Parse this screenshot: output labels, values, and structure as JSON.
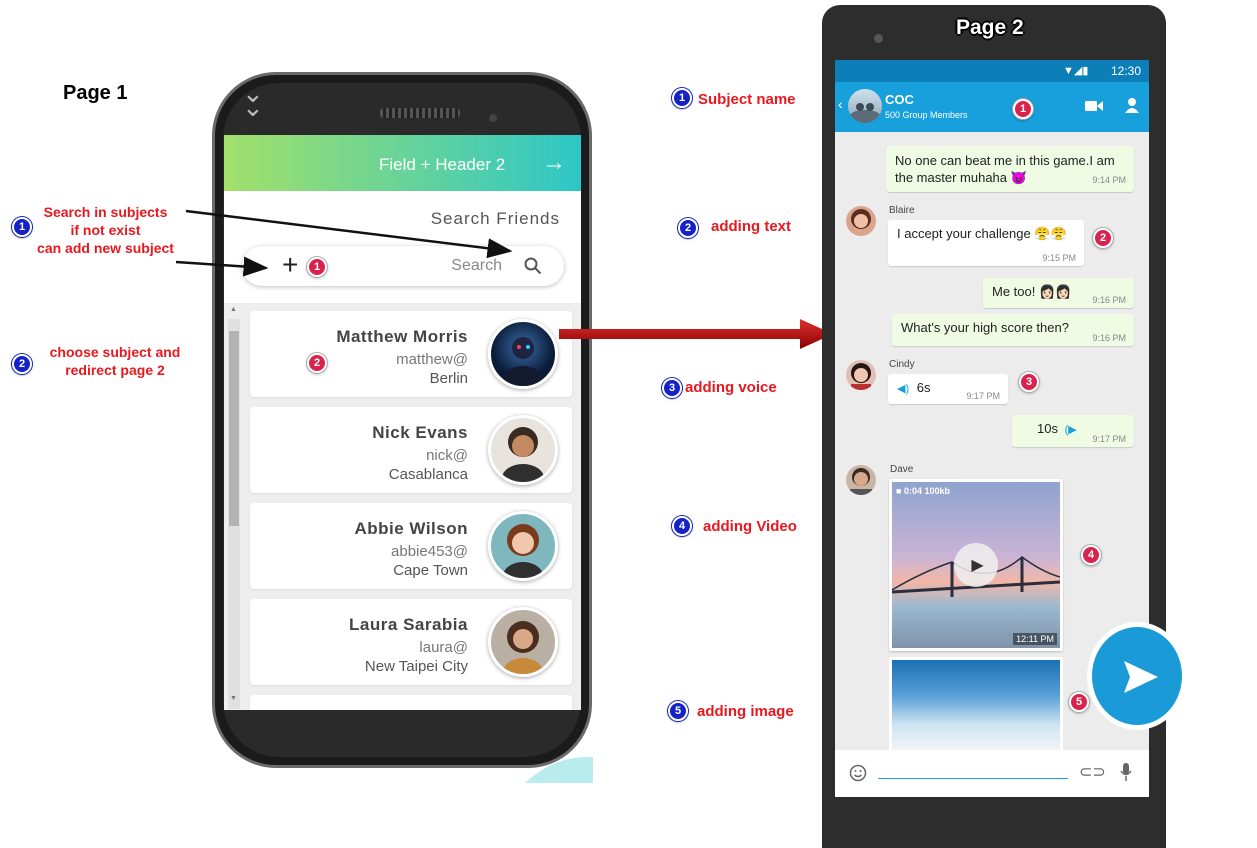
{
  "page1": {
    "title": "Page 1",
    "header_title": "Field + Header 2",
    "search_friends": "Search Friends",
    "search_placeholder": "Search",
    "contacts": [
      {
        "name": "Matthew Morris",
        "user": "matthew@",
        "city": "Berlin"
      },
      {
        "name": "Nick Evans",
        "user": "nick@",
        "city": "Casablanca"
      },
      {
        "name": "Abbie Wilson",
        "user": "abbie453@",
        "city": "Cape Town"
      },
      {
        "name": "Laura Sarabia",
        "user": "laura@",
        "city": "New Taipei City"
      }
    ]
  },
  "notes_left": {
    "n1": "1",
    "n1_lines": [
      "Search in subjects",
      "if not exist",
      "can add new subject"
    ],
    "n2": "2",
    "n2_lines": [
      "choose subject and",
      "redirect page 2"
    ]
  },
  "markers": {
    "m1": "1",
    "m2": "2",
    "m3": "3",
    "m4": "4",
    "m5": "5"
  },
  "notes_middle": {
    "subject_name": "Subject name",
    "adding_text": "adding text",
    "adding_voice": "adding voice",
    "adding_video": "adding Video",
    "adding_image": "adding image"
  },
  "page2": {
    "title": "Page 2",
    "status_time": "12:30",
    "group_name": "COC",
    "group_members": "500 Group Members",
    "messages": [
      {
        "text": "No one can beat me in this game.I am the master muhaha 😈",
        "time": "9:14 PM"
      },
      {
        "sender": "Blaire",
        "text": "I accept your challenge 😤😤",
        "time": "9:15 PM"
      },
      {
        "text": "Me too! 👩🏻👩🏻",
        "time": "9:16 PM"
      },
      {
        "text": "What's your high score then?",
        "time": "9:16 PM"
      },
      {
        "sender": "Cindy",
        "voice": "6s",
        "time": "9:17 PM"
      },
      {
        "voice": "10s",
        "time": "9:17 PM"
      },
      {
        "sender": "Dave",
        "video_meta": "0:04  100kb",
        "time": "12:11 PM"
      }
    ]
  },
  "colors": {
    "accent": "#17a0db",
    "header_start": "#a2e06a",
    "header_end": "#2ec7c7",
    "note_red": "#e8181f",
    "marker_blue": "#1522c8",
    "marker_pink": "#d8234e"
  }
}
